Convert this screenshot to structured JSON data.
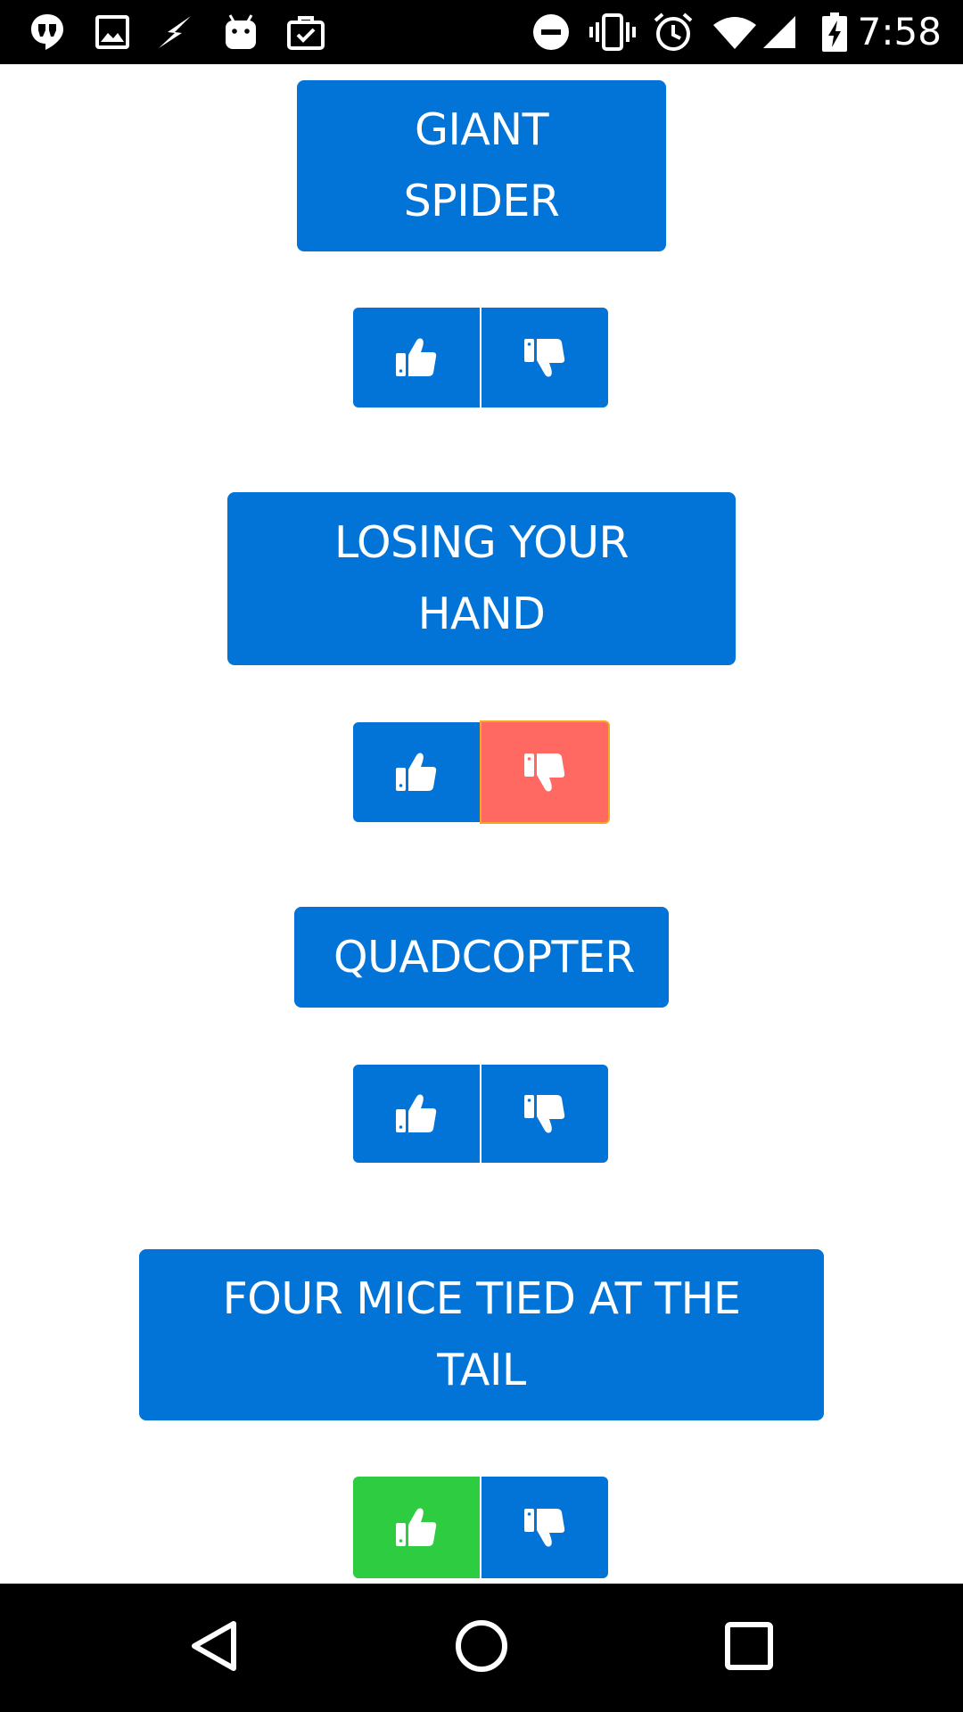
{
  "status_bar": {
    "time": "7:58",
    "left_icons": [
      "hangouts-icon",
      "image-icon",
      "flash-icon",
      "android-icon",
      "briefcase-check-icon"
    ],
    "right_icons": [
      "do-not-disturb-icon",
      "vibrate-icon",
      "alarm-icon",
      "wifi-icon",
      "signal-icon",
      "battery-charging-icon"
    ]
  },
  "items": [
    {
      "title": "GIANT SPIDER",
      "vote": "none"
    },
    {
      "title": "LOSING YOUR HAND",
      "vote": "down"
    },
    {
      "title": "QUADCOPTER",
      "vote": "none"
    },
    {
      "title": "FOUR MICE TIED AT THE TAIL",
      "vote": "up"
    }
  ],
  "colors": {
    "button_blue": "#0274d8",
    "upvote_active": "#2ecc40",
    "downvote_active": "#ff6961",
    "downvote_active_border": "#f5a623"
  },
  "nav_bar": {
    "buttons": [
      "back-icon",
      "home-icon",
      "recents-icon"
    ]
  }
}
